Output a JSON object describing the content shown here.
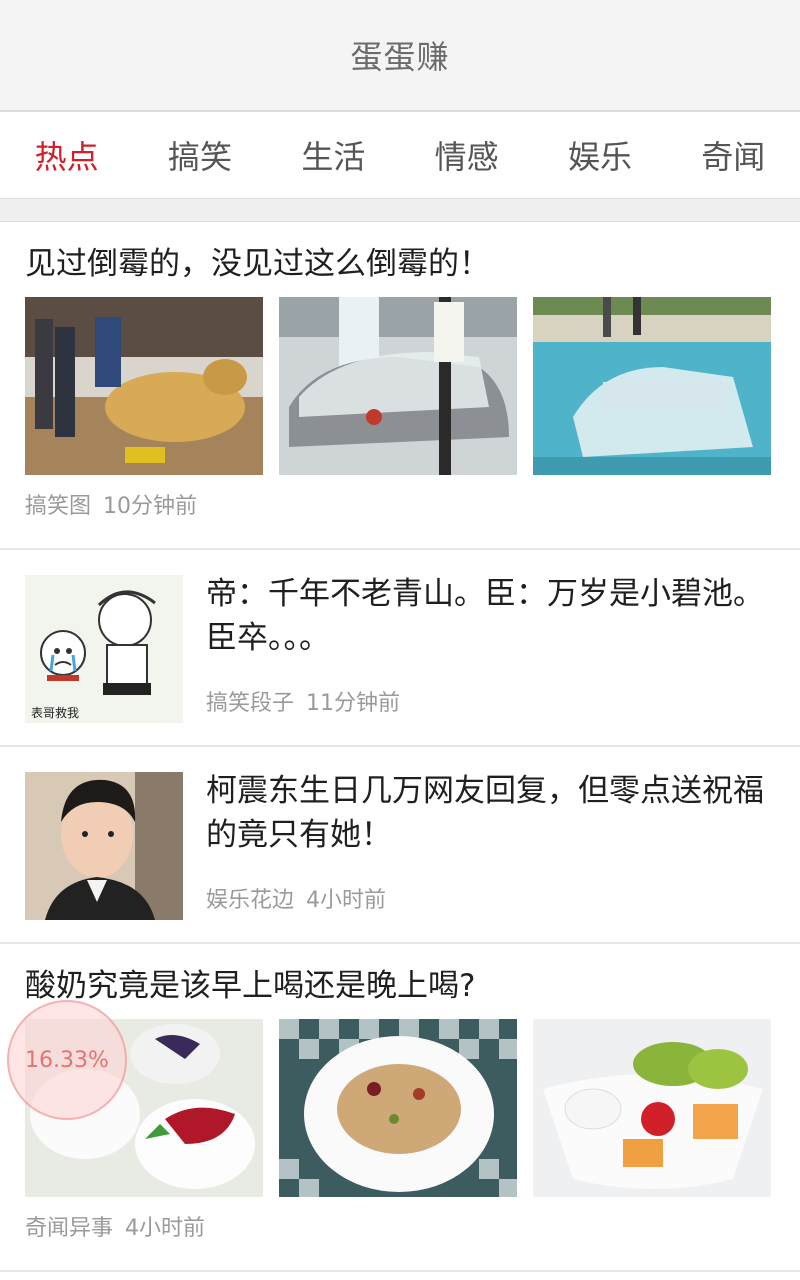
{
  "app": {
    "title": "蛋蛋赚"
  },
  "tabs": [
    {
      "label": "热点",
      "active": true
    },
    {
      "label": "搞笑",
      "active": false
    },
    {
      "label": "生活",
      "active": false
    },
    {
      "label": "情感",
      "active": false
    },
    {
      "label": "娱乐",
      "active": false
    },
    {
      "label": "奇闻",
      "active": false
    }
  ],
  "articles": [
    {
      "title": "见过倒霉的，没见过这么倒霉的！",
      "category": "搞笑图",
      "time": "10分钟前",
      "layout": "three-images"
    },
    {
      "title": "帝：千年不老青山。臣：万岁是小碧池。臣卒。。。",
      "category": "搞笑段子",
      "time": "11分钟前",
      "layout": "single-image",
      "thumb_caption": "表哥救我"
    },
    {
      "title": "柯震东生日几万网友回复，但零点送祝福的竟只有她！",
      "category": "娱乐花边",
      "time": "4小时前",
      "layout": "single-image"
    },
    {
      "title": "酸奶究竟是该早上喝还是晚上喝?",
      "category": "奇闻异事",
      "time": "4小时前",
      "layout": "three-images"
    }
  ],
  "progress": {
    "label": "16.33%",
    "value_percent": 16.33
  },
  "colors": {
    "accent": "#d2202a",
    "text": "#1f1f1f",
    "meta": "#9a9a9a"
  }
}
